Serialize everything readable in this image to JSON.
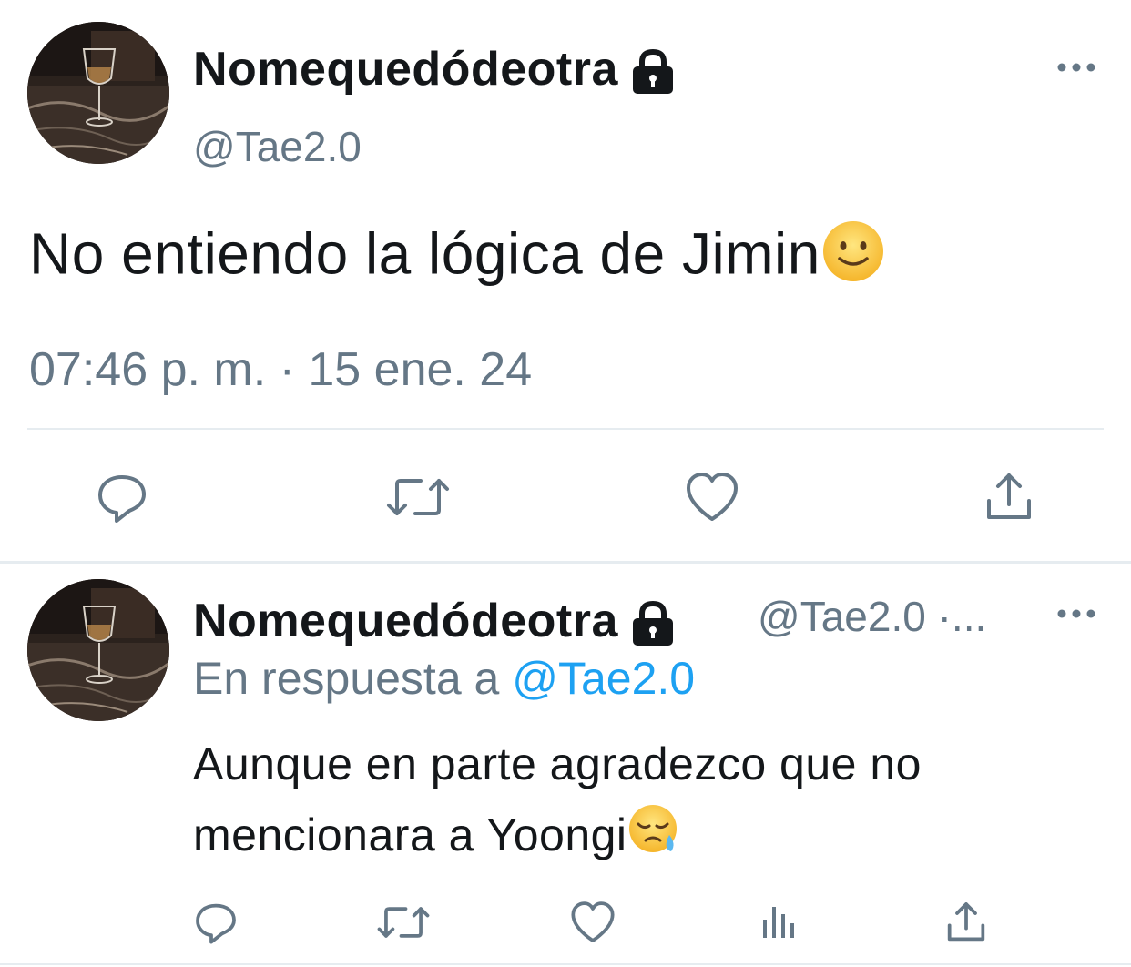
{
  "main_tweet": {
    "display_name": "Nomequedódeotra",
    "handle": "@Tae2.0",
    "text": "No entiendo la lógica de Jimin",
    "timestamp": "07:46 p. m. · 15 ene. 24",
    "emoji": "slightly-smiling-face"
  },
  "reply_tweet": {
    "display_name": "Nomequedódeotra",
    "handle_line": "@Tae2.0 ·...",
    "reply_prefix": "En respuesta a",
    "reply_mention": "@Tae2.0",
    "text": "Aunque en parte agradezco que no mencionara a Yoongi",
    "emoji": "sleepy-face"
  },
  "actions": {
    "main": [
      "reply-icon",
      "retweet-icon",
      "like-icon",
      "share-icon"
    ],
    "reply": [
      "reply-icon",
      "retweet-icon",
      "like-icon",
      "analytics-icon",
      "share-icon"
    ]
  },
  "colors": {
    "text": "#14171a",
    "secondary": "#657786",
    "link": "#1da1f2",
    "divider": "#e6ecf0"
  }
}
